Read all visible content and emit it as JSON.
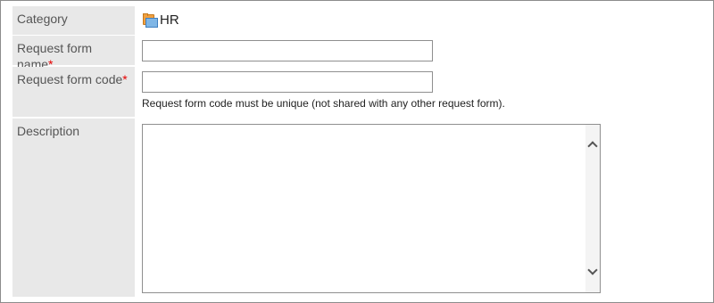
{
  "form": {
    "category": {
      "label": "Category",
      "value": "HR",
      "icon": "folder-icon"
    },
    "request_form_name": {
      "label": "Request form name",
      "required_mark": "*",
      "value": "",
      "placeholder": ""
    },
    "request_form_code": {
      "label": "Request form code",
      "required_mark": "*",
      "value": "",
      "placeholder": "",
      "hint": "Request form code must be unique (not shared with any other request form)."
    },
    "description": {
      "label": "Description",
      "value": ""
    }
  },
  "colors": {
    "label_background": "#e8e8e8",
    "required_mark": "#e60000",
    "border": "#8f8f8f"
  }
}
